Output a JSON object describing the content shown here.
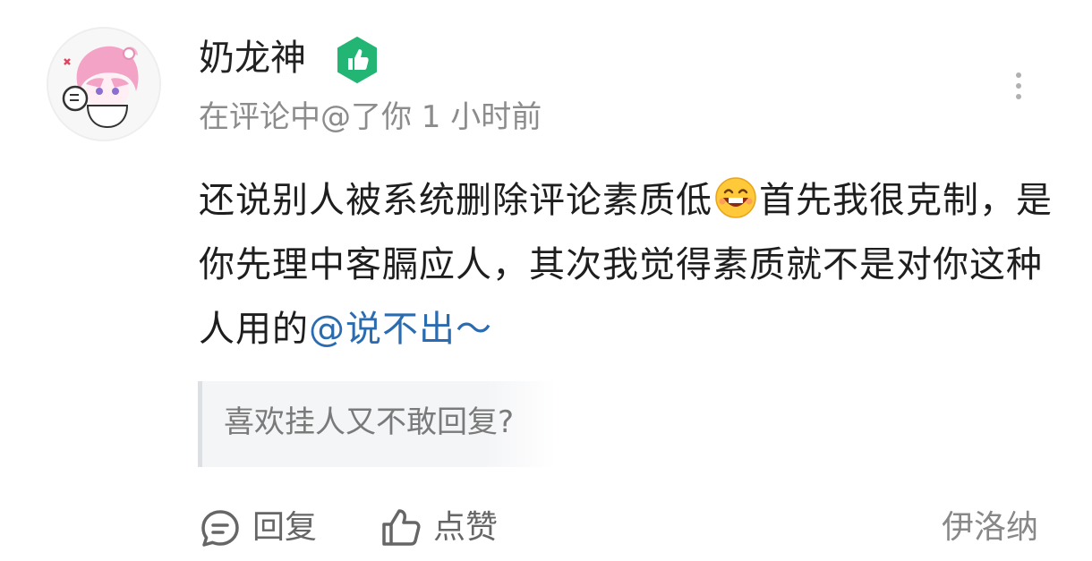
{
  "comment": {
    "username": "奶龙神",
    "meta_text": "在评论中@了你 1 小时前",
    "body_part1": "还说别人被系统删除评论素质低",
    "body_part2": "首先我很克制，是你先理中客膈应人，其次我觉得素质就不是对你这种人用的",
    "mention": "@说不出～",
    "quoted_text": "喜欢挂人又不敢回复?",
    "signature": "伊洛纳"
  },
  "actions": {
    "reply_label": "回复",
    "like_label": "点赞"
  },
  "icons": {
    "badge": "green-thumbs-up-badge-icon",
    "emoji": "grinning-laugh-emoji-icon",
    "more": "vertical-more-dots-icon",
    "reply": "speech-bubble-icon",
    "like": "thumbs-up-outline-icon"
  },
  "colors": {
    "badge_green": "#22b573",
    "mention_blue": "#2b6cb0",
    "meta_gray": "#8c8c8c"
  }
}
